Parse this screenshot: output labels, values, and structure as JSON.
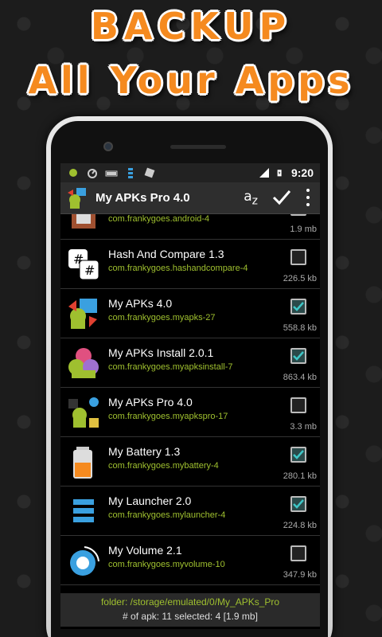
{
  "promo": {
    "line1": "BACKUP",
    "line2": "All Your Apps"
  },
  "statusbar": {
    "time": "9:20"
  },
  "actionbar": {
    "title": "My APKs Pro 4.0",
    "sort_label": "a",
    "sort_sub": "z"
  },
  "apps": [
    {
      "name": "",
      "package": "com.frankygoes.android-4",
      "size": "1.9 mb",
      "checked": false
    },
    {
      "name": "Hash And Compare 1.3",
      "package": "com.frankygoes.hashandcompare-4",
      "size": "226.5 kb",
      "checked": false
    },
    {
      "name": "My APKs 4.0",
      "package": "com.frankygoes.myapks-27",
      "size": "558.8 kb",
      "checked": true
    },
    {
      "name": "My APKs Install 2.0.1",
      "package": "com.frankygoes.myapksinstall-7",
      "size": "863.4 kb",
      "checked": true
    },
    {
      "name": "My APKs Pro 4.0",
      "package": "com.frankygoes.myapkspro-17",
      "size": "3.3 mb",
      "checked": false
    },
    {
      "name": "My Battery 1.3",
      "package": "com.frankygoes.mybattery-4",
      "size": "280.1 kb",
      "checked": true
    },
    {
      "name": "My Launcher 2.0",
      "package": "com.frankygoes.mylauncher-4",
      "size": "224.8 kb",
      "checked": true
    },
    {
      "name": "My Volume 2.1",
      "package": "com.frankygoes.myvolume-10",
      "size": "347.9 kb",
      "checked": false
    }
  ],
  "footer": {
    "folder": "folder: /storage/emulated/0/My_APKs_Pro",
    "stats": "# of apk: 11   selected: 4 [1.9 mb]"
  },
  "colors": {
    "accent": "#f58a1f",
    "package_text": "#9fc02f",
    "check": "#3ec7c7"
  }
}
